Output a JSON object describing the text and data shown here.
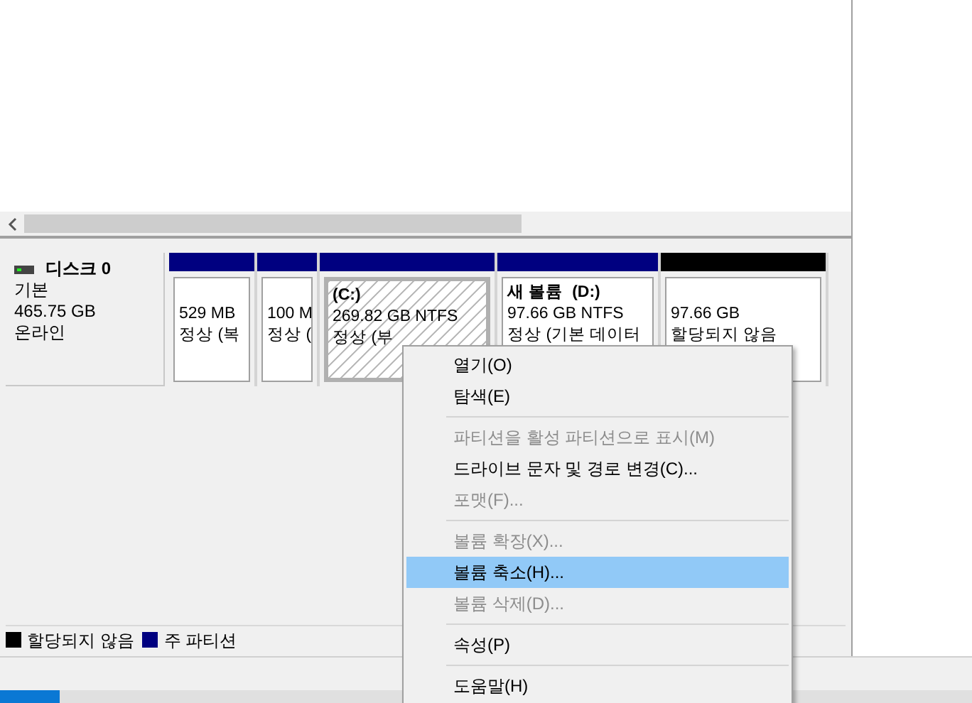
{
  "disk": {
    "name": "디스크 0",
    "type": "기본",
    "size": "465.75 GB",
    "status": "온라인"
  },
  "partitions": [
    {
      "kind": "primary",
      "selected": false,
      "size": "529 MB",
      "status": "정상 (복"
    },
    {
      "kind": "primary",
      "selected": false,
      "size": "100 M",
      "status": "정상 ("
    },
    {
      "kind": "primary",
      "selected": true,
      "label": "(C:)",
      "size": "269.82 GB NTFS",
      "status": "정상 (부"
    },
    {
      "kind": "primary",
      "selected": false,
      "label": "새 볼륨  (D:)",
      "size": "97.66 GB NTFS",
      "status": "정상 (기본 데이터"
    },
    {
      "kind": "unallocated",
      "selected": false,
      "size": "97.66 GB",
      "status": "할당되지 않음"
    }
  ],
  "legend": [
    {
      "label": "할당되지 않음",
      "color": "#000000"
    },
    {
      "label": "주 파티션",
      "color": "#000080"
    }
  ],
  "context_menu": [
    {
      "kind": "item",
      "label": "열기(O)",
      "disabled": false,
      "selected": false
    },
    {
      "kind": "item",
      "label": "탐색(E)",
      "disabled": false,
      "selected": false
    },
    {
      "kind": "separator"
    },
    {
      "kind": "item",
      "label": "파티션을 활성 파티션으로 표시(M)",
      "disabled": true,
      "selected": false
    },
    {
      "kind": "item",
      "label": "드라이브 문자 및 경로 변경(C)...",
      "disabled": false,
      "selected": false
    },
    {
      "kind": "item",
      "label": "포맷(F)...",
      "disabled": true,
      "selected": false
    },
    {
      "kind": "separator"
    },
    {
      "kind": "item",
      "label": "볼륨 확장(X)...",
      "disabled": true,
      "selected": false
    },
    {
      "kind": "item",
      "label": "볼륨 축소(H)...",
      "disabled": false,
      "selected": true
    },
    {
      "kind": "item",
      "label": "볼륨 삭제(D)...",
      "disabled": true,
      "selected": false
    },
    {
      "kind": "separator"
    },
    {
      "kind": "item",
      "label": "속성(P)",
      "disabled": false,
      "selected": false
    },
    {
      "kind": "separator"
    },
    {
      "kind": "item",
      "label": "도움말(H)",
      "disabled": false,
      "selected": false
    }
  ]
}
